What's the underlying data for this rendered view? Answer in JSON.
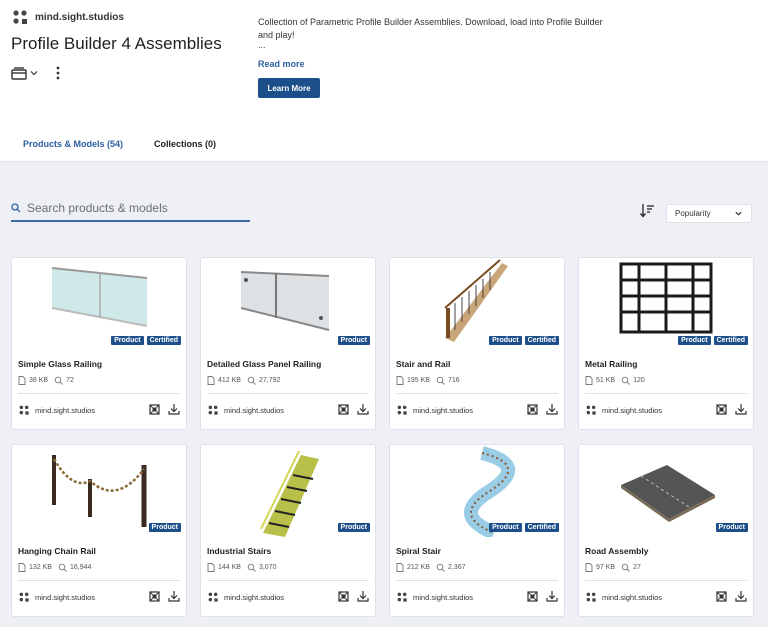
{
  "header": {
    "brand_name": "mind.sight.studios",
    "title": "Profile Builder 4 Assemblies",
    "description": "Collection of Parametric Profile Builder Assemblies. Download, load into Profile Builder and play!",
    "ellipsis": "...",
    "read_more": "Read more",
    "learn_more": "Learn More"
  },
  "tabs": {
    "products": "Products & Models (54)",
    "collections": "Collections (0)"
  },
  "search": {
    "placeholder": "Search products & models"
  },
  "sort": {
    "selected": "Popularity"
  },
  "cards": [
    {
      "name": "Simple Glass Railing",
      "size": "38 KB",
      "views": "72",
      "badges": [
        "Product",
        "Certified"
      ],
      "author": "mind.sight.studios"
    },
    {
      "name": "Detailed Glass Panel Railing",
      "size": "412 KB",
      "views": "27,792",
      "badges": [
        "Product"
      ],
      "author": "mind.sight.studios"
    },
    {
      "name": "Stair and Rail",
      "size": "195 KB",
      "views": "716",
      "badges": [
        "Product",
        "Certified"
      ],
      "author": "mind.sight.studios"
    },
    {
      "name": "Metal Railing",
      "size": "51 KB",
      "views": "120",
      "badges": [
        "Product",
        "Certified"
      ],
      "author": "mind.sight.studios"
    },
    {
      "name": "Hanging Chain Rail",
      "size": "132 KB",
      "views": "16,944",
      "badges": [
        "Product"
      ],
      "author": "mind.sight.studios"
    },
    {
      "name": "Industrial Stairs",
      "size": "144 KB",
      "views": "3,070",
      "badges": [
        "Product"
      ],
      "author": "mind.sight.studios"
    },
    {
      "name": "Spiral Stair",
      "size": "212 KB",
      "views": "2,367",
      "badges": [
        "Product",
        "Certified"
      ],
      "author": "mind.sight.studios"
    },
    {
      "name": "Road Assembly",
      "size": "97 KB",
      "views": "27",
      "badges": [
        "Product"
      ],
      "author": "mind.sight.studios"
    }
  ],
  "colors": {
    "accent": "#1d4f8a",
    "link": "#2d5fa0",
    "background": "#eef0f5"
  }
}
